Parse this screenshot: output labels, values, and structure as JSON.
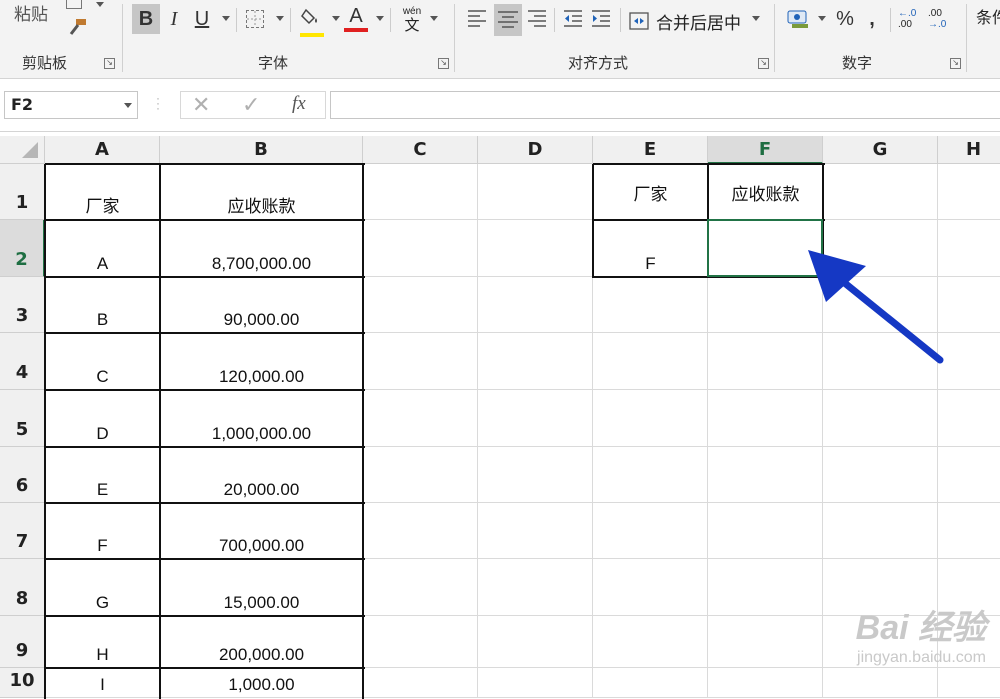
{
  "ribbon": {
    "paste_label": "粘贴",
    "groups": {
      "clipboard": "剪贴板",
      "font": "字体",
      "alignment": "对齐方式",
      "number": "数字"
    },
    "bold": "B",
    "italic": "I",
    "underline": "U",
    "font_color_glyph": "A",
    "phonetic_top": "wén",
    "phonetic_bottom": "文",
    "merge_center": "合并后居中",
    "percent": "%",
    "comma": ",",
    "increase_decimal": ".00",
    "conditional_format_partial": "条件",
    "accent_fill": "#ffe600",
    "accent_font": "#e02020"
  },
  "formula_bar": {
    "name_box": "F2",
    "fx": "fx"
  },
  "columns": [
    "A",
    "B",
    "C",
    "D",
    "E",
    "F",
    "G",
    "H"
  ],
  "rows": [
    "1",
    "2",
    "3",
    "4",
    "5",
    "6",
    "7",
    "8",
    "9",
    "10"
  ],
  "table_left": {
    "header": [
      "厂家",
      "应收账款"
    ],
    "rows": [
      [
        "A",
        "8,700,000.00"
      ],
      [
        "B",
        "90,000.00"
      ],
      [
        "C",
        "120,000.00"
      ],
      [
        "D",
        "1,000,000.00"
      ],
      [
        "E",
        "20,000.00"
      ],
      [
        "F",
        "700,000.00"
      ],
      [
        "G",
        "15,000.00"
      ],
      [
        "H",
        "200,000.00"
      ],
      [
        "I",
        "1,000.00"
      ]
    ]
  },
  "table_right": {
    "header": [
      "厂家",
      "应收账款"
    ],
    "row": [
      "F",
      ""
    ]
  },
  "selection": {
    "cell": "F2",
    "accent": "#217346"
  },
  "annotation": {
    "arrow_color": "#1538c4",
    "points_to": "F2"
  },
  "watermark": {
    "line1": "Bai 经验",
    "line2": "jingyan.baidu.com"
  }
}
